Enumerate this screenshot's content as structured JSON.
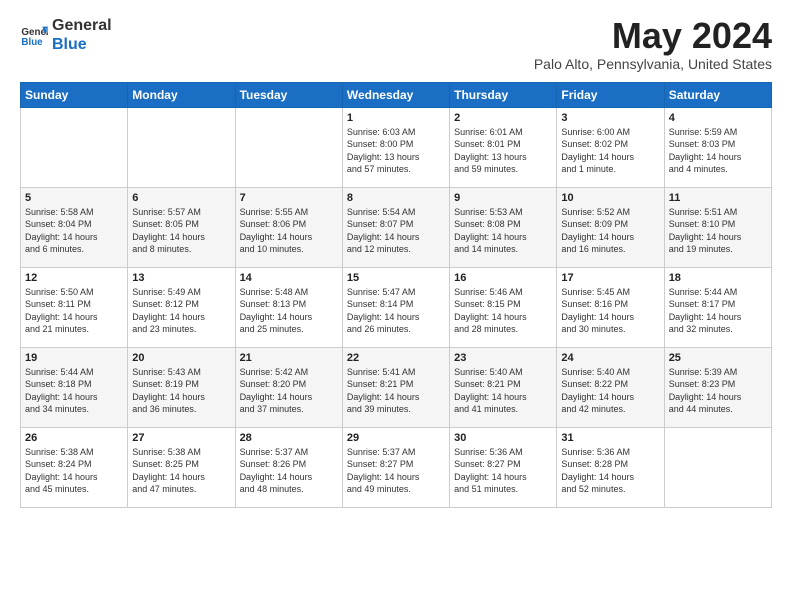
{
  "logo": {
    "line1": "General",
    "line2": "Blue"
  },
  "title": "May 2024",
  "subtitle": "Palo Alto, Pennsylvania, United States",
  "days_of_week": [
    "Sunday",
    "Monday",
    "Tuesday",
    "Wednesday",
    "Thursday",
    "Friday",
    "Saturday"
  ],
  "weeks": [
    [
      {
        "day": "",
        "info": ""
      },
      {
        "day": "",
        "info": ""
      },
      {
        "day": "",
        "info": ""
      },
      {
        "day": "1",
        "info": "Sunrise: 6:03 AM\nSunset: 8:00 PM\nDaylight: 13 hours\nand 57 minutes."
      },
      {
        "day": "2",
        "info": "Sunrise: 6:01 AM\nSunset: 8:01 PM\nDaylight: 13 hours\nand 59 minutes."
      },
      {
        "day": "3",
        "info": "Sunrise: 6:00 AM\nSunset: 8:02 PM\nDaylight: 14 hours\nand 1 minute."
      },
      {
        "day": "4",
        "info": "Sunrise: 5:59 AM\nSunset: 8:03 PM\nDaylight: 14 hours\nand 4 minutes."
      }
    ],
    [
      {
        "day": "5",
        "info": "Sunrise: 5:58 AM\nSunset: 8:04 PM\nDaylight: 14 hours\nand 6 minutes."
      },
      {
        "day": "6",
        "info": "Sunrise: 5:57 AM\nSunset: 8:05 PM\nDaylight: 14 hours\nand 8 minutes."
      },
      {
        "day": "7",
        "info": "Sunrise: 5:55 AM\nSunset: 8:06 PM\nDaylight: 14 hours\nand 10 minutes."
      },
      {
        "day": "8",
        "info": "Sunrise: 5:54 AM\nSunset: 8:07 PM\nDaylight: 14 hours\nand 12 minutes."
      },
      {
        "day": "9",
        "info": "Sunrise: 5:53 AM\nSunset: 8:08 PM\nDaylight: 14 hours\nand 14 minutes."
      },
      {
        "day": "10",
        "info": "Sunrise: 5:52 AM\nSunset: 8:09 PM\nDaylight: 14 hours\nand 16 minutes."
      },
      {
        "day": "11",
        "info": "Sunrise: 5:51 AM\nSunset: 8:10 PM\nDaylight: 14 hours\nand 19 minutes."
      }
    ],
    [
      {
        "day": "12",
        "info": "Sunrise: 5:50 AM\nSunset: 8:11 PM\nDaylight: 14 hours\nand 21 minutes."
      },
      {
        "day": "13",
        "info": "Sunrise: 5:49 AM\nSunset: 8:12 PM\nDaylight: 14 hours\nand 23 minutes."
      },
      {
        "day": "14",
        "info": "Sunrise: 5:48 AM\nSunset: 8:13 PM\nDaylight: 14 hours\nand 25 minutes."
      },
      {
        "day": "15",
        "info": "Sunrise: 5:47 AM\nSunset: 8:14 PM\nDaylight: 14 hours\nand 26 minutes."
      },
      {
        "day": "16",
        "info": "Sunrise: 5:46 AM\nSunset: 8:15 PM\nDaylight: 14 hours\nand 28 minutes."
      },
      {
        "day": "17",
        "info": "Sunrise: 5:45 AM\nSunset: 8:16 PM\nDaylight: 14 hours\nand 30 minutes."
      },
      {
        "day": "18",
        "info": "Sunrise: 5:44 AM\nSunset: 8:17 PM\nDaylight: 14 hours\nand 32 minutes."
      }
    ],
    [
      {
        "day": "19",
        "info": "Sunrise: 5:44 AM\nSunset: 8:18 PM\nDaylight: 14 hours\nand 34 minutes."
      },
      {
        "day": "20",
        "info": "Sunrise: 5:43 AM\nSunset: 8:19 PM\nDaylight: 14 hours\nand 36 minutes."
      },
      {
        "day": "21",
        "info": "Sunrise: 5:42 AM\nSunset: 8:20 PM\nDaylight: 14 hours\nand 37 minutes."
      },
      {
        "day": "22",
        "info": "Sunrise: 5:41 AM\nSunset: 8:21 PM\nDaylight: 14 hours\nand 39 minutes."
      },
      {
        "day": "23",
        "info": "Sunrise: 5:40 AM\nSunset: 8:21 PM\nDaylight: 14 hours\nand 41 minutes."
      },
      {
        "day": "24",
        "info": "Sunrise: 5:40 AM\nSunset: 8:22 PM\nDaylight: 14 hours\nand 42 minutes."
      },
      {
        "day": "25",
        "info": "Sunrise: 5:39 AM\nSunset: 8:23 PM\nDaylight: 14 hours\nand 44 minutes."
      }
    ],
    [
      {
        "day": "26",
        "info": "Sunrise: 5:38 AM\nSunset: 8:24 PM\nDaylight: 14 hours\nand 45 minutes."
      },
      {
        "day": "27",
        "info": "Sunrise: 5:38 AM\nSunset: 8:25 PM\nDaylight: 14 hours\nand 47 minutes."
      },
      {
        "day": "28",
        "info": "Sunrise: 5:37 AM\nSunset: 8:26 PM\nDaylight: 14 hours\nand 48 minutes."
      },
      {
        "day": "29",
        "info": "Sunrise: 5:37 AM\nSunset: 8:27 PM\nDaylight: 14 hours\nand 49 minutes."
      },
      {
        "day": "30",
        "info": "Sunrise: 5:36 AM\nSunset: 8:27 PM\nDaylight: 14 hours\nand 51 minutes."
      },
      {
        "day": "31",
        "info": "Sunrise: 5:36 AM\nSunset: 8:28 PM\nDaylight: 14 hours\nand 52 minutes."
      },
      {
        "day": "",
        "info": ""
      }
    ]
  ]
}
